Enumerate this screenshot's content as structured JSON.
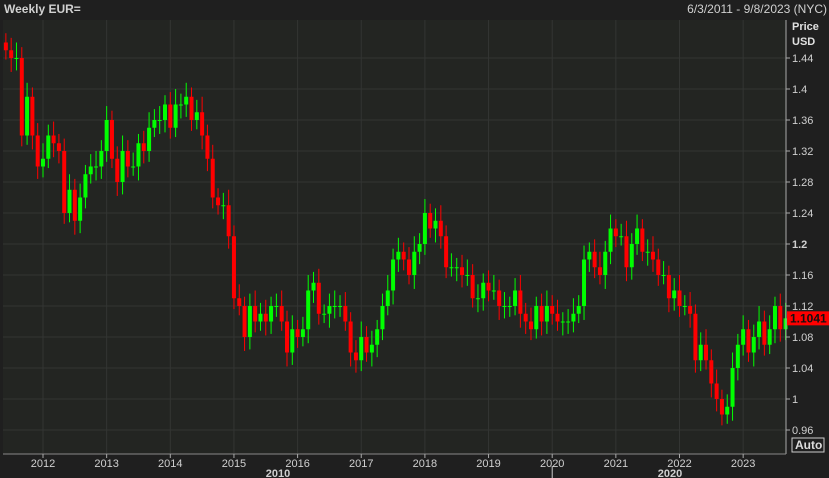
{
  "header": {
    "title": "Weekly EUR=",
    "range": "6/3/2011 - 9/8/2023 (NYC)"
  },
  "axis": {
    "price_label": "Price",
    "currency_label": "USD",
    "auto_button": "Auto",
    "last_price": "1.1041"
  },
  "colors": {
    "up": "#00ff00",
    "down": "#ff0000",
    "background": "#1f1f1f",
    "plot": "#232522",
    "grid": "#333533"
  },
  "chart_data": {
    "type": "candlestick",
    "title": "Weekly EUR=",
    "ylabel": "Price USD",
    "ylim": [
      0.94,
      1.47
    ],
    "yticks": [
      "1.44",
      "1.4",
      "1.36",
      "1.32",
      "1.28",
      "1.24",
      "1.2",
      "1.16",
      "1.12",
      "1.08",
      "1.04",
      "1",
      "0.96"
    ],
    "xticks": [
      "2012",
      "2013",
      "2014",
      "2015",
      "2016",
      "2017",
      "2018",
      "2019",
      "2020",
      "2021",
      "2022",
      "2023"
    ],
    "xmajor": [
      "2010",
      "2020"
    ],
    "start": [
      2011,
      6
    ],
    "monthly_closes": [
      1.45,
      1.44,
      1.44,
      1.34,
      1.39,
      1.34,
      1.3,
      1.31,
      1.34,
      1.33,
      1.32,
      1.24,
      1.27,
      1.23,
      1.26,
      1.29,
      1.3,
      1.3,
      1.32,
      1.36,
      1.31,
      1.28,
      1.32,
      1.3,
      1.3,
      1.33,
      1.32,
      1.35,
      1.36,
      1.36,
      1.38,
      1.35,
      1.38,
      1.38,
      1.39,
      1.36,
      1.37,
      1.34,
      1.31,
      1.26,
      1.25,
      1.25,
      1.21,
      1.13,
      1.12,
      1.08,
      1.12,
      1.1,
      1.11,
      1.1,
      1.12,
      1.12,
      1.1,
      1.06,
      1.09,
      1.08,
      1.09,
      1.14,
      1.15,
      1.11,
      1.11,
      1.12,
      1.12,
      1.12,
      1.1,
      1.06,
      1.05,
      1.08,
      1.06,
      1.07,
      1.09,
      1.12,
      1.14,
      1.18,
      1.19,
      1.18,
      1.16,
      1.19,
      1.2,
      1.24,
      1.22,
      1.23,
      1.21,
      1.17,
      1.17,
      1.17,
      1.16,
      1.16,
      1.13,
      1.13,
      1.15,
      1.14,
      1.14,
      1.12,
      1.12,
      1.12,
      1.14,
      1.11,
      1.1,
      1.09,
      1.12,
      1.1,
      1.12,
      1.11,
      1.1,
      1.1,
      1.1,
      1.11,
      1.12,
      1.18,
      1.19,
      1.17,
      1.16,
      1.19,
      1.22,
      1.21,
      1.21,
      1.17,
      1.2,
      1.22,
      1.19,
      1.19,
      1.18,
      1.16,
      1.16,
      1.13,
      1.14,
      1.12,
      1.12,
      1.11,
      1.05,
      1.07,
      1.05,
      1.02,
      1.0,
      0.98,
      0.99,
      1.04,
      1.07,
      1.09,
      1.06,
      1.08,
      1.1,
      1.07,
      1.09,
      1.12,
      1.09,
      1.1041
    ],
    "last": 1.1041
  }
}
